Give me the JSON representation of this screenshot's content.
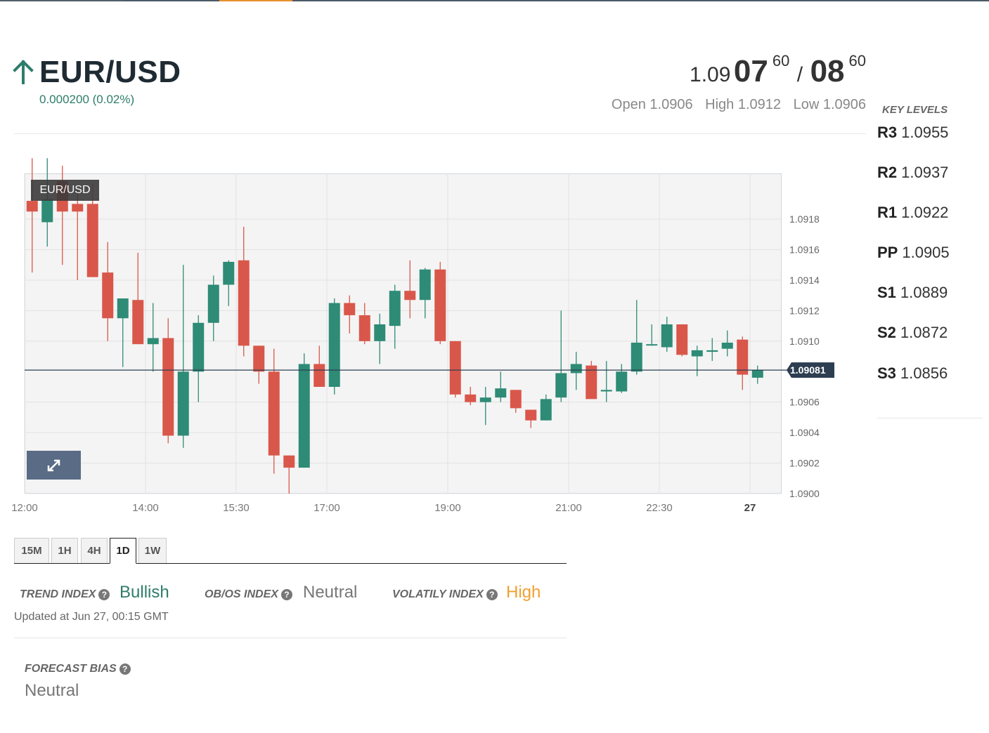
{
  "top_tabs_accent_color": "#e8902a",
  "instrument": {
    "pair": "EUR/USD",
    "direction_icon": "arrow-up-icon",
    "change": "0.000200 (0.02%)",
    "change_color": "#2e7d6b"
  },
  "quote": {
    "bid_prefix": "1.09",
    "bid_big": "07",
    "bid_pip": "60",
    "separator": "/",
    "ask_big": "08",
    "ask_pip": "60",
    "open": "Open 1.0906",
    "high": "High 1.0912",
    "low": "Low 1.0906"
  },
  "key_levels": {
    "title": "KEY LEVELS",
    "levels": [
      {
        "name": "R3",
        "value": "1.0955"
      },
      {
        "name": "R2",
        "value": "1.0937"
      },
      {
        "name": "R1",
        "value": "1.0922"
      },
      {
        "name": "PP",
        "value": "1.0905"
      },
      {
        "name": "S1",
        "value": "1.0889"
      },
      {
        "name": "S2",
        "value": "1.0872"
      },
      {
        "name": "S3",
        "value": "1.0856"
      }
    ]
  },
  "chart": {
    "legend": "EUR/USD",
    "expand_icon": "expand-arrows-icon",
    "current_price_label": "1.09081",
    "up_color": "#2e8b76",
    "down_color": "#d9574a"
  },
  "chart_data": {
    "type": "candlestick",
    "y_ticks": [
      "1.0918",
      "1.0916",
      "1.0914",
      "1.0912",
      "1.0910",
      "1.0906",
      "1.0904",
      "1.0902",
      "1.0900"
    ],
    "ylim": [
      1.09,
      1.0921
    ],
    "current_price": 1.09081,
    "x_ticks": [
      {
        "label": "12:00",
        "index": 0,
        "bold": false
      },
      {
        "label": "14:00",
        "index": 8,
        "bold": false
      },
      {
        "label": "15:30",
        "index": 14,
        "bold": false
      },
      {
        "label": "17:00",
        "index": 20,
        "bold": false
      },
      {
        "label": "19:00",
        "index": 28,
        "bold": false
      },
      {
        "label": "21:00",
        "index": 36,
        "bold": false
      },
      {
        "label": "22:30",
        "index": 42,
        "bold": false
      },
      {
        "label": "27",
        "index": 48,
        "bold": true
      }
    ],
    "candles": [
      {
        "o": 1.09192,
        "h": 1.0922,
        "l": 1.09145,
        "c": 1.09185
      },
      {
        "o": 1.09178,
        "h": 1.0922,
        "l": 1.09162,
        "c": 1.09193
      },
      {
        "o": 1.09205,
        "h": 1.09215,
        "l": 1.0915,
        "c": 1.09185
      },
      {
        "o": 1.0919,
        "h": 1.092,
        "l": 1.0914,
        "c": 1.09185
      },
      {
        "o": 1.0919,
        "h": 1.09203,
        "l": 1.09142,
        "c": 1.09142
      },
      {
        "o": 1.09145,
        "h": 1.09165,
        "l": 1.091,
        "c": 1.09115
      },
      {
        "o": 1.09115,
        "h": 1.09125,
        "l": 1.09083,
        "c": 1.09128
      },
      {
        "o": 1.09127,
        "h": 1.09158,
        "l": 1.091,
        "c": 1.09098
      },
      {
        "o": 1.09098,
        "h": 1.09125,
        "l": 1.0908,
        "c": 1.09102
      },
      {
        "o": 1.09102,
        "h": 1.09115,
        "l": 1.09033,
        "c": 1.09038
      },
      {
        "o": 1.09038,
        "h": 1.0915,
        "l": 1.0903,
        "c": 1.0908
      },
      {
        "o": 1.0908,
        "h": 1.09117,
        "l": 1.0906,
        "c": 1.09112
      },
      {
        "o": 1.09112,
        "h": 1.09143,
        "l": 1.091,
        "c": 1.09137
      },
      {
        "o": 1.09137,
        "h": 1.09153,
        "l": 1.09123,
        "c": 1.09152
      },
      {
        "o": 1.09153,
        "h": 1.09175,
        "l": 1.0909,
        "c": 1.09097
      },
      {
        "o": 1.09097,
        "h": 1.09097,
        "l": 1.09072,
        "c": 1.0908
      },
      {
        "o": 1.0908,
        "h": 1.09095,
        "l": 1.09013,
        "c": 1.09025
      },
      {
        "o": 1.09025,
        "h": 1.09025,
        "l": 1.09,
        "c": 1.09017
      },
      {
        "o": 1.09017,
        "h": 1.09092,
        "l": 1.09017,
        "c": 1.09085
      },
      {
        "o": 1.09085,
        "h": 1.09097,
        "l": 1.0907,
        "c": 1.0907
      },
      {
        "o": 1.0907,
        "h": 1.09128,
        "l": 1.09065,
        "c": 1.09125
      },
      {
        "o": 1.09125,
        "h": 1.0913,
        "l": 1.09105,
        "c": 1.09117
      },
      {
        "o": 1.09117,
        "h": 1.09125,
        "l": 1.09098,
        "c": 1.091
      },
      {
        "o": 1.091,
        "h": 1.09118,
        "l": 1.09085,
        "c": 1.09111
      },
      {
        "o": 1.0911,
        "h": 1.09137,
        "l": 1.09095,
        "c": 1.09133
      },
      {
        "o": 1.09133,
        "h": 1.09153,
        "l": 1.09115,
        "c": 1.09127
      },
      {
        "o": 1.09127,
        "h": 1.09148,
        "l": 1.09115,
        "c": 1.09147
      },
      {
        "o": 1.09147,
        "h": 1.09152,
        "l": 1.09098,
        "c": 1.091
      },
      {
        "o": 1.091,
        "h": 1.091,
        "l": 1.09063,
        "c": 1.09065
      },
      {
        "o": 1.09065,
        "h": 1.0907,
        "l": 1.09058,
        "c": 1.0906
      },
      {
        "o": 1.0906,
        "h": 1.0907,
        "l": 1.09045,
        "c": 1.09063
      },
      {
        "o": 1.09063,
        "h": 1.0908,
        "l": 1.0906,
        "c": 1.09069
      },
      {
        "o": 1.09068,
        "h": 1.09068,
        "l": 1.09053,
        "c": 1.09056
      },
      {
        "o": 1.09055,
        "h": 1.09055,
        "l": 1.09043,
        "c": 1.09048
      },
      {
        "o": 1.09048,
        "h": 1.09065,
        "l": 1.09048,
        "c": 1.09062
      },
      {
        "o": 1.09063,
        "h": 1.0912,
        "l": 1.0906,
        "c": 1.09079
      },
      {
        "o": 1.09079,
        "h": 1.09093,
        "l": 1.09068,
        "c": 1.09085
      },
      {
        "o": 1.09084,
        "h": 1.09087,
        "l": 1.09063,
        "c": 1.09062
      },
      {
        "o": 1.09067,
        "h": 1.09087,
        "l": 1.0906,
        "c": 1.09068
      },
      {
        "o": 1.09067,
        "h": 1.09085,
        "l": 1.09066,
        "c": 1.0908
      },
      {
        "o": 1.0908,
        "h": 1.09127,
        "l": 1.09078,
        "c": 1.09099
      },
      {
        "o": 1.09098,
        "h": 1.09111,
        "l": 1.09097,
        "c": 1.09098
      },
      {
        "o": 1.09096,
        "h": 1.09116,
        "l": 1.09093,
        "c": 1.09111
      },
      {
        "o": 1.09111,
        "h": 1.09111,
        "l": 1.0909,
        "c": 1.09091
      },
      {
        "o": 1.0909,
        "h": 1.09097,
        "l": 1.09077,
        "c": 1.09094
      },
      {
        "o": 1.09093,
        "h": 1.09102,
        "l": 1.09087,
        "c": 1.09094
      },
      {
        "o": 1.09095,
        "h": 1.09107,
        "l": 1.0909,
        "c": 1.09099
      },
      {
        "o": 1.09101,
        "h": 1.09103,
        "l": 1.09068,
        "c": 1.09078
      },
      {
        "o": 1.09076,
        "h": 1.09084,
        "l": 1.09072,
        "c": 1.09081
      }
    ]
  },
  "timeframes": {
    "tabs": [
      "15M",
      "1H",
      "4H",
      "1D",
      "1W"
    ],
    "active": "1D"
  },
  "indices": {
    "trend_label": "TREND INDEX",
    "trend_value": "Bullish",
    "trend_color": "#2e7d6b",
    "obos_label": "OB/OS INDEX",
    "obos_value": "Neutral",
    "obos_color": "#777777",
    "volatility_label": "VOLATILY INDEX",
    "volatility_value": "High",
    "volatility_color": "#f0a030",
    "help_icon": "question-circle-icon",
    "updated": "Updated at Jun 27, 00:15 GMT"
  },
  "forecast": {
    "label": "FORECAST BIAS",
    "value": "Neutral"
  }
}
